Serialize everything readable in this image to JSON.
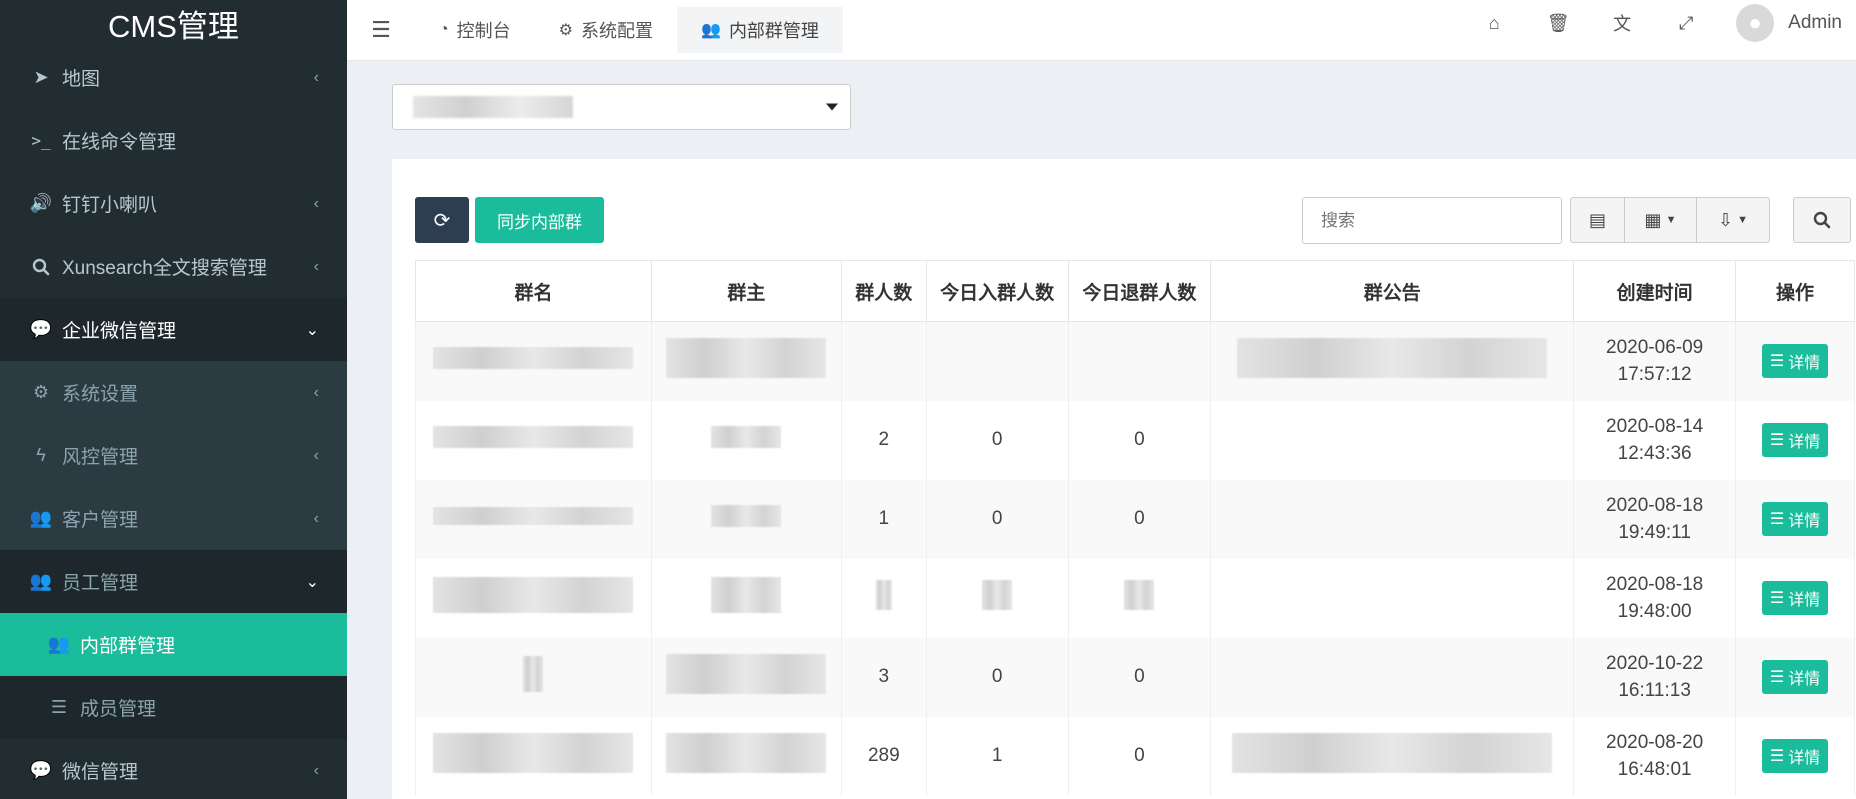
{
  "sidebar": {
    "brand": "CMS管理",
    "items": [
      {
        "label": "地图",
        "icon": "location-arrow-icon",
        "arrow": "‹"
      },
      {
        "label": "在线命令管理",
        "icon": "terminal-icon",
        "arrow": ""
      },
      {
        "label": "钉钉小喇叭",
        "icon": "volume-icon",
        "arrow": "‹"
      },
      {
        "label": "Xunsearch全文搜索管理",
        "icon": "search-icon",
        "arrow": "‹"
      },
      {
        "label": "企业微信管理",
        "icon": "wechat-icon",
        "arrow": "⌄"
      },
      {
        "label": "系统设置",
        "icon": "gear-icon",
        "arrow": "‹"
      },
      {
        "label": "风控管理",
        "icon": "bolt-icon",
        "arrow": "‹"
      },
      {
        "label": "客户管理",
        "icon": "users-icon",
        "arrow": "‹"
      },
      {
        "label": "员工管理",
        "icon": "users-icon",
        "arrow": "⌄"
      },
      {
        "label": "内部群管理",
        "icon": "users-icon",
        "arrow": ""
      },
      {
        "label": "成员管理",
        "icon": "list-icon",
        "arrow": ""
      },
      {
        "label": "微信管理",
        "icon": "wechat-icon",
        "arrow": "‹"
      }
    ]
  },
  "header": {
    "tabs": [
      {
        "label": "控制台",
        "icon": "dashboard-icon"
      },
      {
        "label": "系统配置",
        "icon": "gear-icon"
      },
      {
        "label": "内部群管理",
        "icon": "users-icon"
      }
    ],
    "user": "Admin"
  },
  "toolbar": {
    "sync_label": "同步内部群",
    "search_placeholder": "搜索"
  },
  "table": {
    "headers": [
      "群名",
      "群主",
      "群人数",
      "今日入群人数",
      "今日退群人数",
      "群公告",
      "创建时间",
      "操作"
    ],
    "rows": [
      {
        "members": "",
        "joined": "",
        "left": "",
        "date": "2020-06-09",
        "time": "17:57:12"
      },
      {
        "members": "2",
        "joined": "0",
        "left": "0",
        "date": "2020-08-14",
        "time": "12:43:36"
      },
      {
        "members": "1",
        "joined": "0",
        "left": "0",
        "date": "2020-08-18",
        "time": "19:49:11"
      },
      {
        "members": "",
        "joined": "",
        "left": "",
        "date": "2020-08-18",
        "time": "19:48:00"
      },
      {
        "members": "3",
        "joined": "0",
        "left": "0",
        "date": "2020-10-22",
        "time": "16:11:13"
      },
      {
        "members": "289",
        "joined": "1",
        "left": "0",
        "date": "2020-08-20",
        "time": "16:48:01"
      }
    ],
    "detail_label": "详情"
  }
}
